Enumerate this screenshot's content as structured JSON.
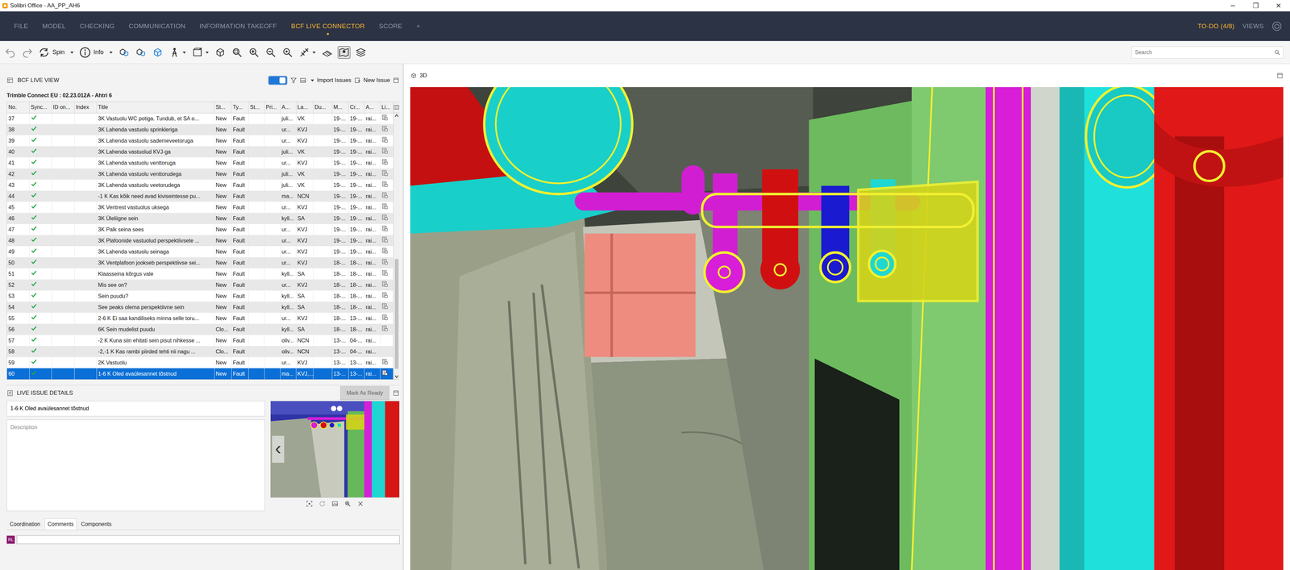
{
  "window": {
    "title": "Solibri Office - AA_PP_AH6",
    "controls": [
      "─",
      "❐",
      "✕"
    ]
  },
  "menu": {
    "items": [
      {
        "label": "FILE",
        "selected": false
      },
      {
        "label": "MODEL",
        "selected": false
      },
      {
        "label": "CHECKING",
        "selected": false
      },
      {
        "label": "COMMUNICATION",
        "selected": false
      },
      {
        "label": "INFORMATION TAKEOFF",
        "selected": false
      },
      {
        "label": "BCF LIVE CONNECTOR",
        "selected": true
      },
      {
        "label": "SCORE",
        "selected": false
      },
      {
        "label": "+",
        "selected": false
      }
    ],
    "todo": "TO-DO (4/8)",
    "views": "VIEWS"
  },
  "toolbar": {
    "spin": "Spin",
    "info": "Info",
    "search_placeholder": "Search",
    "pin_on": true
  },
  "bcf": {
    "title": "BCF LIVE VIEW",
    "live": true,
    "import": "Import Issues",
    "new": "New Issue",
    "project": "Trimble Connect EU : 02.23.012A - Ahtri 6",
    "columns": [
      "No.",
      "Sync...",
      "ID on...",
      "Index",
      "Title",
      "St...",
      "Ty...",
      "St...",
      "Pri...",
      "A...",
      "La...",
      "Du...",
      "M...",
      "Cr...",
      "A...",
      "Li..."
    ],
    "scroll_position": 0.55,
    "rows": [
      {
        "no": "37",
        "synced": true,
        "title": "3K Vastuolu WC potiga. Tundub, et SA o...",
        "status": "New",
        "type": "Fault",
        "assigned": "juli...",
        "label": "VK",
        "modified": "19-...",
        "created": "19-...",
        "author": "rai...",
        "linked": true,
        "selected": false
      },
      {
        "no": "38",
        "synced": true,
        "title": "3K Lahenda vastuolu sprinkleriga",
        "status": "New",
        "type": "Fault",
        "assigned": "ur...",
        "label": "KVJ",
        "modified": "19-...",
        "created": "19-...",
        "author": "rai...",
        "linked": true,
        "selected": false
      },
      {
        "no": "39",
        "synced": true,
        "title": "3K Lahenda vastuolu sademeveetoruga",
        "status": "New",
        "type": "Fault",
        "assigned": "ur...",
        "label": "KVJ",
        "modified": "19-...",
        "created": "19-...",
        "author": "rai...",
        "linked": true,
        "selected": false
      },
      {
        "no": "40",
        "synced": true,
        "title": "3K Lahenda vastuolud KVJ-ga",
        "status": "New",
        "type": "Fault",
        "assigned": "juli...",
        "label": "VK",
        "modified": "19-...",
        "created": "19-...",
        "author": "rai...",
        "linked": true,
        "selected": false
      },
      {
        "no": "41",
        "synced": true,
        "title": "3K Lahenda vastuolu venttoruga",
        "status": "New",
        "type": "Fault",
        "assigned": "ur...",
        "label": "KVJ",
        "modified": "19-...",
        "created": "19-...",
        "author": "rai...",
        "linked": true,
        "selected": false
      },
      {
        "no": "42",
        "synced": true,
        "title": "3K Lahenda vastuolu venttorudega",
        "status": "New",
        "type": "Fault",
        "assigned": "juli...",
        "label": "VK",
        "modified": "19-...",
        "created": "19-...",
        "author": "rai...",
        "linked": true,
        "selected": false
      },
      {
        "no": "43",
        "synced": true,
        "title": "3K Lahenda vastuolu veetorudega",
        "status": "New",
        "type": "Fault",
        "assigned": "juli...",
        "label": "VK",
        "modified": "19-...",
        "created": "19-...",
        "author": "rai...",
        "linked": true,
        "selected": false
      },
      {
        "no": "44",
        "synced": true,
        "title": "-1 K Kas kõik need avad kiviseintesse pu...",
        "status": "New",
        "type": "Fault",
        "assigned": "ma...",
        "label": "NCN",
        "modified": "19-...",
        "created": "19-...",
        "author": "rai...",
        "linked": true,
        "selected": false
      },
      {
        "no": "45",
        "synced": true,
        "title": "3K Ventrest vastuolus uksega",
        "status": "New",
        "type": "Fault",
        "assigned": "ur...",
        "label": "KVJ",
        "modified": "19-...",
        "created": "19-...",
        "author": "rai...",
        "linked": true,
        "selected": false
      },
      {
        "no": "46",
        "synced": true,
        "title": "3K Üleliigne sein",
        "status": "New",
        "type": "Fault",
        "assigned": "kyll...",
        "label": "SA",
        "modified": "19-...",
        "created": "19-...",
        "author": "rai...",
        "linked": true,
        "selected": false
      },
      {
        "no": "47",
        "synced": true,
        "title": "3K Palk seina sees",
        "status": "New",
        "type": "Fault",
        "assigned": "ur...",
        "label": "KVJ",
        "modified": "19-...",
        "created": "19-...",
        "author": "rai...",
        "linked": true,
        "selected": false
      },
      {
        "no": "48",
        "synced": true,
        "title": "3K Plafoonide vastuolud perspektiivsete ...",
        "status": "New",
        "type": "Fault",
        "assigned": "ur...",
        "label": "KVJ",
        "modified": "19-...",
        "created": "19-...",
        "author": "rai...",
        "linked": true,
        "selected": false
      },
      {
        "no": "49",
        "synced": true,
        "title": "3K Lahenda vastuolu seinaga",
        "status": "New",
        "type": "Fault",
        "assigned": "ur...",
        "label": "KVJ",
        "modified": "19-...",
        "created": "19-...",
        "author": "rai...",
        "linked": true,
        "selected": false
      },
      {
        "no": "50",
        "synced": true,
        "title": "3K Ventplafoon jookseb perspektiivse sei...",
        "status": "New",
        "type": "Fault",
        "assigned": "ur...",
        "label": "KVJ",
        "modified": "18-...",
        "created": "18-...",
        "author": "rai...",
        "linked": true,
        "selected": false
      },
      {
        "no": "51",
        "synced": true,
        "title": "Klaasseina kõrgus vale",
        "status": "New",
        "type": "Fault",
        "assigned": "kyll...",
        "label": "SA",
        "modified": "18-...",
        "created": "18-...",
        "author": "rai...",
        "linked": true,
        "selected": false
      },
      {
        "no": "52",
        "synced": true,
        "title": "Mis see on?",
        "status": "New",
        "type": "Fault",
        "assigned": "ur...",
        "label": "KVJ",
        "modified": "18-...",
        "created": "18-...",
        "author": "rai...",
        "linked": true,
        "selected": false
      },
      {
        "no": "53",
        "synced": true,
        "title": "Sein puudu?",
        "status": "New",
        "type": "Fault",
        "assigned": "kyll...",
        "label": "SA",
        "modified": "18-...",
        "created": "18-...",
        "author": "rai...",
        "linked": true,
        "selected": false
      },
      {
        "no": "54",
        "synced": true,
        "title": "See peaks olema perspektiivne sein",
        "status": "New",
        "type": "Fault",
        "assigned": "kyll...",
        "label": "SA",
        "modified": "18-...",
        "created": "18-...",
        "author": "rai...",
        "linked": true,
        "selected": false
      },
      {
        "no": "55",
        "synced": true,
        "title": "2-6 K Ei saa kandiliseks minna selle toru...",
        "status": "New",
        "type": "Fault",
        "assigned": "ur...",
        "label": "KVJ",
        "modified": "18-...",
        "created": "13-...",
        "author": "rai...",
        "linked": true,
        "selected": false
      },
      {
        "no": "56",
        "synced": true,
        "title": "6K Sein mudelist puudu",
        "status": "Clo...",
        "type": "Fault",
        "assigned": "kyll...",
        "label": "SA",
        "modified": "18-...",
        "created": "18-...",
        "author": "rai...",
        "linked": true,
        "selected": false
      },
      {
        "no": "57",
        "synced": true,
        "title": "-2 K Kuna siin ehitati sein pisut nihkesse ...",
        "status": "New",
        "type": "Fault",
        "assigned": "oliv...",
        "label": "NCN",
        "modified": "13-...",
        "created": "04-...",
        "author": "rai...",
        "linked": false,
        "selected": false
      },
      {
        "no": "58",
        "synced": true,
        "title": "-2,-1 K Kas rambi piirded tehti nii nagu ...",
        "status": "Clo...",
        "type": "Fault",
        "assigned": "oliv...",
        "label": "NCN",
        "modified": "13-...",
        "created": "04-...",
        "author": "rai...",
        "linked": false,
        "selected": false
      },
      {
        "no": "59",
        "synced": true,
        "title": "2K Vastuolu",
        "status": "New",
        "type": "Fault",
        "assigned": "ur...",
        "label": "KVJ",
        "modified": "13-...",
        "created": "13-...",
        "author": "rai...",
        "linked": true,
        "selected": false
      },
      {
        "no": "60",
        "synced": true,
        "title": "1-6 K Oled avaülesannet tõstnud",
        "status": "New",
        "type": "Fault",
        "assigned": "ma...",
        "label": "KVJ,...",
        "modified": "13-...",
        "created": "13-...",
        "author": "rai...",
        "linked": true,
        "selected": true
      }
    ]
  },
  "details": {
    "header": "LIVE ISSUE DETAILS",
    "mark_ready": "Mark As Ready",
    "mark_ready_disabled": true,
    "issue_title": "1-6 K Oled avaülesannet tõstnud",
    "description_placeholder": "Description",
    "prev": "‹",
    "tabs": [
      {
        "label": "Coordination",
        "selected": false
      },
      {
        "label": "Comments",
        "selected": true
      },
      {
        "label": "Components",
        "selected": false
      }
    ],
    "avatar": "RL"
  },
  "view": {
    "label": "3D"
  }
}
